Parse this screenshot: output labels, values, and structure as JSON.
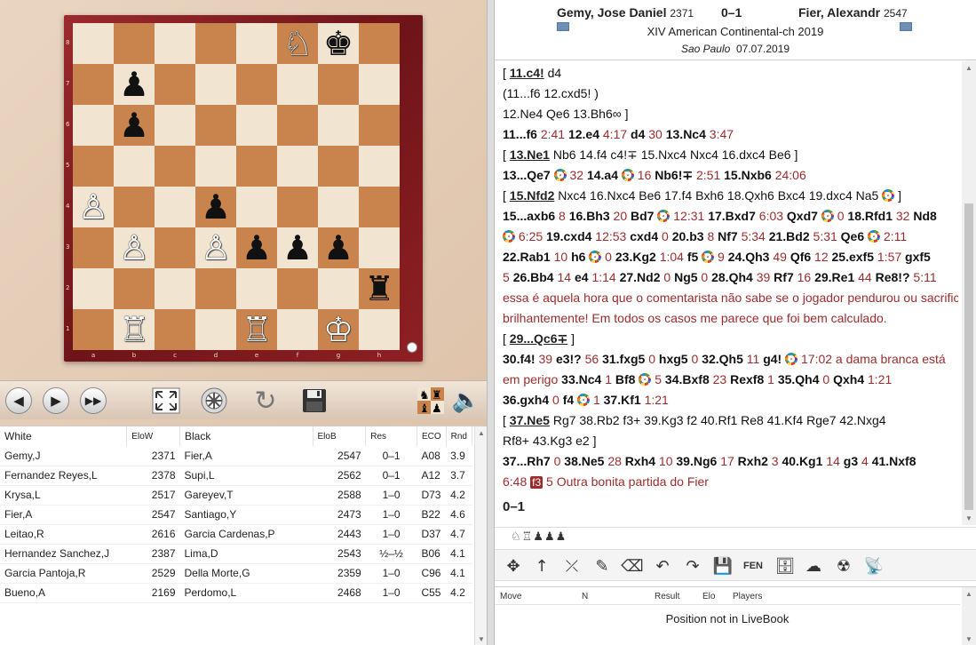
{
  "board": {
    "ranks": [
      "8",
      "7",
      "6",
      "5",
      "4",
      "3",
      "2",
      "1"
    ],
    "files": [
      "a",
      "b",
      "c",
      "d",
      "e",
      "f",
      "g",
      "h"
    ],
    "pieces": [
      {
        "square": "f8",
        "glyph": "♘",
        "color": "w",
        "name": "white-knight-icon"
      },
      {
        "square": "g8",
        "glyph": "♚",
        "color": "b",
        "name": "black-king-icon"
      },
      {
        "square": "b7",
        "glyph": "♟",
        "color": "b",
        "name": "black-pawn-icon"
      },
      {
        "square": "b6",
        "glyph": "♟",
        "color": "b",
        "name": "black-pawn-icon"
      },
      {
        "square": "a4",
        "glyph": "♙",
        "color": "w",
        "name": "white-pawn-icon"
      },
      {
        "square": "d4",
        "glyph": "♟",
        "color": "b",
        "name": "black-pawn-icon"
      },
      {
        "square": "b3",
        "glyph": "♙",
        "color": "w",
        "name": "white-pawn-icon"
      },
      {
        "square": "d3",
        "glyph": "♙",
        "color": "w",
        "name": "white-pawn-icon"
      },
      {
        "square": "e3",
        "glyph": "♟",
        "color": "b",
        "name": "black-pawn-icon"
      },
      {
        "square": "f3",
        "glyph": "♟",
        "color": "b",
        "name": "black-pawn-icon"
      },
      {
        "square": "g3",
        "glyph": "♟",
        "color": "b",
        "name": "black-pawn-icon"
      },
      {
        "square": "h2",
        "glyph": "♜",
        "color": "b",
        "name": "black-rook-icon"
      },
      {
        "square": "b1",
        "glyph": "♖",
        "color": "w",
        "name": "white-rook-icon"
      },
      {
        "square": "e1",
        "glyph": "♖",
        "color": "w",
        "name": "white-rook-icon"
      },
      {
        "square": "g1",
        "glyph": "♔",
        "color": "w",
        "name": "white-king-icon"
      }
    ]
  },
  "toolbar": {
    "buttons": [
      {
        "name": "back-arrow-icon",
        "glyph": "🡐"
      },
      {
        "name": "forward-arrow-icon",
        "glyph": "🡒"
      },
      {
        "name": "fast-forward-icon",
        "glyph": "⏩"
      },
      {
        "name": "fullscreen-icon",
        "glyph": "⤢"
      },
      {
        "name": "engine-wheel-icon",
        "glyph": "⚙"
      },
      {
        "name": "rotate-board-icon",
        "glyph": "↻"
      },
      {
        "name": "save-disk-icon",
        "glyph": "💾"
      },
      {
        "name": "piece-set-icon",
        "glyph": "♞"
      },
      {
        "name": "sound-speaker-icon",
        "glyph": "🔈"
      }
    ]
  },
  "game_list": {
    "columns": [
      "White",
      "EloW",
      "Black",
      "EloB",
      "Res",
      "ECO",
      "Rnd"
    ],
    "rows": [
      [
        "Gemy,J",
        "2371",
        "Fier,A",
        "2547",
        "0–1",
        "A08",
        "3.9"
      ],
      [
        "Fernandez Reyes,L",
        "2378",
        "Supi,L",
        "2562",
        "0–1",
        "A12",
        "3.7"
      ],
      [
        "Krysa,L",
        "2517",
        "Gareyev,T",
        "2588",
        "1–0",
        "D73",
        "4.2"
      ],
      [
        "Fier,A",
        "2547",
        "Santiago,Y",
        "2473",
        "1–0",
        "B22",
        "4.6"
      ],
      [
        "Leitao,R",
        "2616",
        "Garcia Cardenas,P",
        "2443",
        "1–0",
        "D37",
        "4.7"
      ],
      [
        "Hernandez Sanchez,J",
        "2387",
        "Lima,D",
        "2543",
        "½–½",
        "B06",
        "4.1"
      ],
      [
        "Garcia Pantoja,R",
        "2529",
        "Della Morte,G",
        "2359",
        "1–0",
        "C96",
        "4.1"
      ],
      [
        "Bueno,A",
        "2169",
        "Perdomo,L",
        "2468",
        "1–0",
        "C55",
        "4.2"
      ]
    ]
  },
  "header": {
    "white": "Gemy, Jose Daniel",
    "white_elo": "2371",
    "result": "0–1",
    "black": "Fier, Alexandr",
    "black_elo": "2547",
    "event": "XIV American Continental-ch 2019",
    "site": "Sao Paulo",
    "date": "07.07.2019"
  },
  "notation": {
    "lines": [
      [
        {
          "t": "[ ",
          "c": "var"
        },
        {
          "t": "11.c4!",
          "c": "ul"
        },
        {
          "t": " d4",
          "c": "var"
        }
      ],
      [
        {
          "t": "    (11...f6 ",
          "c": "var"
        },
        {
          "t": "12.cxd5! )",
          "c": "var"
        }
      ],
      [
        {
          "t": "  12.Ne4 Qe6 13.Bh6∞ ]",
          "c": "var"
        }
      ],
      [
        {
          "t": "11...f6 ",
          "c": "mv"
        },
        {
          "t": "2:41 ",
          "c": "tm"
        },
        {
          "t": "12.e4 ",
          "c": "mv"
        },
        {
          "t": "4:17 ",
          "c": "tm"
        },
        {
          "t": "d4 ",
          "c": "mv"
        },
        {
          "t": "30 ",
          "c": "tm"
        },
        {
          "t": "13.Nc4 ",
          "c": "mv"
        },
        {
          "t": "3:47",
          "c": "tm"
        }
      ],
      [
        {
          "t": "  [ ",
          "c": "var"
        },
        {
          "t": "13.Ne1",
          "c": "ul"
        },
        {
          "t": " Nb6 14.f4 c4!∓ 15.Nxc4 Nxc4 16.dxc4 Be6 ]",
          "c": "var"
        }
      ],
      [
        {
          "t": "13...Qe7 ",
          "c": "mv"
        },
        {
          "t": "@"
        },
        {
          "t": " 32 ",
          "c": "tm"
        },
        {
          "t": "14.a4 ",
          "c": "mv"
        },
        {
          "t": "@"
        },
        {
          "t": " 16 ",
          "c": "tm"
        },
        {
          "t": "Nb6!∓ ",
          "c": "mv"
        },
        {
          "t": "2:51 ",
          "c": "tm"
        },
        {
          "t": "15.Nxb6 ",
          "c": "mv"
        },
        {
          "t": "24:06",
          "c": "tm"
        }
      ],
      [
        {
          "t": "  [ ",
          "c": "var"
        },
        {
          "t": "15.Nfd2",
          "c": "ul"
        },
        {
          "t": " Nxc4 16.Nxc4 Be6 17.f4 Bxh6 18.Qxh6 Bxc4 19.dxc4 Na5 ",
          "c": "var"
        },
        {
          "t": "@"
        },
        {
          "t": " ]",
          "c": "var"
        }
      ],
      [
        {
          "t": "15...axb6 ",
          "c": "mv"
        },
        {
          "t": "8 ",
          "c": "tm"
        },
        {
          "t": "16.Bh3 ",
          "c": "mv"
        },
        {
          "t": "20 ",
          "c": "tm"
        },
        {
          "t": "Bd7 ",
          "c": "mv"
        },
        {
          "t": "@"
        },
        {
          "t": " 12:31 ",
          "c": "tm"
        },
        {
          "t": "17.Bxd7 ",
          "c": "mv"
        },
        {
          "t": "6:03 ",
          "c": "tm"
        },
        {
          "t": "Qxd7 ",
          "c": "mv"
        },
        {
          "t": "@"
        },
        {
          "t": " 0 ",
          "c": "tm"
        },
        {
          "t": "18.Rfd1 ",
          "c": "mv"
        },
        {
          "t": "32 ",
          "c": "tm"
        },
        {
          "t": "Nd8",
          "c": "mv"
        }
      ],
      [
        {
          "t": "@"
        },
        {
          "t": " 6:25 ",
          "c": "tm"
        },
        {
          "t": "19.cxd4 ",
          "c": "mv"
        },
        {
          "t": "12:53 ",
          "c": "tm"
        },
        {
          "t": "cxd4 ",
          "c": "mv"
        },
        {
          "t": "0 ",
          "c": "tm"
        },
        {
          "t": "20.b3 ",
          "c": "mv"
        },
        {
          "t": "8 ",
          "c": "tm"
        },
        {
          "t": "Nf7 ",
          "c": "mv"
        },
        {
          "t": "5:34 ",
          "c": "tm"
        },
        {
          "t": "21.Bd2 ",
          "c": "mv"
        },
        {
          "t": "5:31 ",
          "c": "tm"
        },
        {
          "t": "Qe6 ",
          "c": "mv"
        },
        {
          "t": "@"
        },
        {
          "t": " 2:11",
          "c": "tm"
        }
      ],
      [
        {
          "t": "22.Rab1 ",
          "c": "mv"
        },
        {
          "t": "10 ",
          "c": "tm"
        },
        {
          "t": "h6 ",
          "c": "mv"
        },
        {
          "t": "@"
        },
        {
          "t": " 0 ",
          "c": "tm"
        },
        {
          "t": "23.Kg2 ",
          "c": "mv"
        },
        {
          "t": "1:04 ",
          "c": "tm"
        },
        {
          "t": "f5 ",
          "c": "mv"
        },
        {
          "t": "@"
        },
        {
          "t": " 9 ",
          "c": "tm"
        },
        {
          "t": "24.Qh3 ",
          "c": "mv"
        },
        {
          "t": "49 ",
          "c": "tm"
        },
        {
          "t": "Qf6 ",
          "c": "mv"
        },
        {
          "t": "12 ",
          "c": "tm"
        },
        {
          "t": "25.exf5 ",
          "c": "mv"
        },
        {
          "t": "1:57 ",
          "c": "tm"
        },
        {
          "t": "gxf5",
          "c": "mv"
        }
      ],
      [
        {
          "t": "5 ",
          "c": "tm"
        },
        {
          "t": "26.Bb4 ",
          "c": "mv"
        },
        {
          "t": "14 ",
          "c": "tm"
        },
        {
          "t": "e4 ",
          "c": "mv"
        },
        {
          "t": "1:14 ",
          "c": "tm"
        },
        {
          "t": "27.Nd2 ",
          "c": "mv"
        },
        {
          "t": "0 ",
          "c": "tm"
        },
        {
          "t": "Ng5 ",
          "c": "mv"
        },
        {
          "t": "0 ",
          "c": "tm"
        },
        {
          "t": "28.Qh4 ",
          "c": "mv"
        },
        {
          "t": "39 ",
          "c": "tm"
        },
        {
          "t": "Rf7 ",
          "c": "mv"
        },
        {
          "t": "16 ",
          "c": "tm"
        },
        {
          "t": "29.Re1 ",
          "c": "mv"
        },
        {
          "t": "44 ",
          "c": "tm"
        },
        {
          "t": "Re8!? ",
          "c": "mv"
        },
        {
          "t": "5:11",
          "c": "tm"
        }
      ],
      [
        {
          "t": "essa é aquela hora que o comentarista não sabe se o jogador pendurou ou sacrificou",
          "c": "cm"
        }
      ],
      [
        {
          "t": "brilhantemente! Em todos os casos me parece que foi bem calculado.",
          "c": "cm"
        }
      ],
      [
        {
          "t": "  [ ",
          "c": "var"
        },
        {
          "t": "29...Qc6∓",
          "c": "ul"
        },
        {
          "t": " ]",
          "c": "var"
        }
      ],
      [
        {
          "t": "30.f4! ",
          "c": "mv"
        },
        {
          "t": "39 ",
          "c": "tm"
        },
        {
          "t": "e3!? ",
          "c": "mv"
        },
        {
          "t": "56 ",
          "c": "tm"
        },
        {
          "t": "31.fxg5 ",
          "c": "mv"
        },
        {
          "t": "0 ",
          "c": "tm"
        },
        {
          "t": "hxg5 ",
          "c": "mv"
        },
        {
          "t": "0 ",
          "c": "tm"
        },
        {
          "t": "32.Qh5 ",
          "c": "mv"
        },
        {
          "t": "11 ",
          "c": "tm"
        },
        {
          "t": "g4! ",
          "c": "mv"
        },
        {
          "t": "@"
        },
        {
          "t": " 17:02 a dama branca está",
          "c": "tm"
        }
      ],
      [
        {
          "t": "em perigo ",
          "c": "cm"
        },
        {
          "t": "33.Nc4 ",
          "c": "mv"
        },
        {
          "t": "1 ",
          "c": "tm"
        },
        {
          "t": "Bf8 ",
          "c": "mv"
        },
        {
          "t": "@"
        },
        {
          "t": " 5 ",
          "c": "tm"
        },
        {
          "t": "34.Bxf8 ",
          "c": "mv"
        },
        {
          "t": "23 ",
          "c": "tm"
        },
        {
          "t": "Rexf8 ",
          "c": "mv"
        },
        {
          "t": "1 ",
          "c": "tm"
        },
        {
          "t": "35.Qh4 ",
          "c": "mv"
        },
        {
          "t": "0 ",
          "c": "tm"
        },
        {
          "t": "Qxh4 ",
          "c": "mv"
        },
        {
          "t": "1:21",
          "c": "tm"
        }
      ],
      [
        {
          "t": "36.gxh4 ",
          "c": "mv"
        },
        {
          "t": "0 ",
          "c": "tm"
        },
        {
          "t": "f4 ",
          "c": "mv"
        },
        {
          "t": "@"
        },
        {
          "t": " 1 ",
          "c": "tm"
        },
        {
          "t": "37.Kf1 ",
          "c": "mv"
        },
        {
          "t": "1:21",
          "c": "tm"
        }
      ],
      [
        {
          "t": "  [ ",
          "c": "var"
        },
        {
          "t": "37.Ne5",
          "c": "ul"
        },
        {
          "t": " Rg7 38.Rb2 f3+ 39.Kg3 f2 40.Rf1 Re8 41.Kf4 Rge7 42.Nxg4",
          "c": "var"
        }
      ],
      [
        {
          "t": "  Rf8+ 43.Kg3 e2 ]",
          "c": "var"
        }
      ],
      [
        {
          "t": "37...Rh7 ",
          "c": "mv"
        },
        {
          "t": "0 ",
          "c": "tm"
        },
        {
          "t": "38.Ne5 ",
          "c": "mv"
        },
        {
          "t": "28 ",
          "c": "tm"
        },
        {
          "t": "Rxh4 ",
          "c": "mv"
        },
        {
          "t": "10 ",
          "c": "tm"
        },
        {
          "t": "39.Ng6 ",
          "c": "mv"
        },
        {
          "t": "17 ",
          "c": "tm"
        },
        {
          "t": "Rxh2 ",
          "c": "mv"
        },
        {
          "t": "3 ",
          "c": "tm"
        },
        {
          "t": "40.Kg1 ",
          "c": "mv"
        },
        {
          "t": "14 ",
          "c": "tm"
        },
        {
          "t": "g3 ",
          "c": "mv"
        },
        {
          "t": "4 ",
          "c": "tm"
        },
        {
          "t": "41.Nxf8",
          "c": "mv"
        }
      ],
      [
        {
          "t": "6:48 ",
          "c": "tm"
        },
        {
          "t": "f3",
          "c": "box"
        },
        {
          "t": " 5 Outra bonita partida do Fier",
          "c": "tm"
        }
      ]
    ],
    "result": "0–1"
  },
  "material": "♘♖♟♟♟",
  "edit_toolbar": {
    "buttons": [
      {
        "name": "move-arrows-icon",
        "glyph": "✥"
      },
      {
        "name": "promote-variation-icon",
        "glyph": "↑"
      },
      {
        "name": "delete-move-icon",
        "glyph": "⤫"
      },
      {
        "name": "comment-pen-icon",
        "glyph": "✎"
      },
      {
        "name": "eraser-icon",
        "glyph": "⌫"
      },
      {
        "name": "undo-icon",
        "glyph": "↶"
      },
      {
        "name": "redo-icon",
        "glyph": "↷"
      },
      {
        "name": "save-icon",
        "glyph": "💾"
      },
      {
        "name": "fen-button",
        "glyph": "FEN"
      },
      {
        "name": "database-icon",
        "glyph": "🗄"
      },
      {
        "name": "cloud-icon",
        "glyph": "☁"
      },
      {
        "name": "engine-cloud-icon",
        "glyph": "☢"
      },
      {
        "name": "broadcast-icon",
        "glyph": "📡"
      }
    ]
  },
  "livebook": {
    "columns": [
      "Move",
      "N",
      "Result",
      "Elo",
      "Players"
    ],
    "message": "Position not in LiveBook"
  }
}
